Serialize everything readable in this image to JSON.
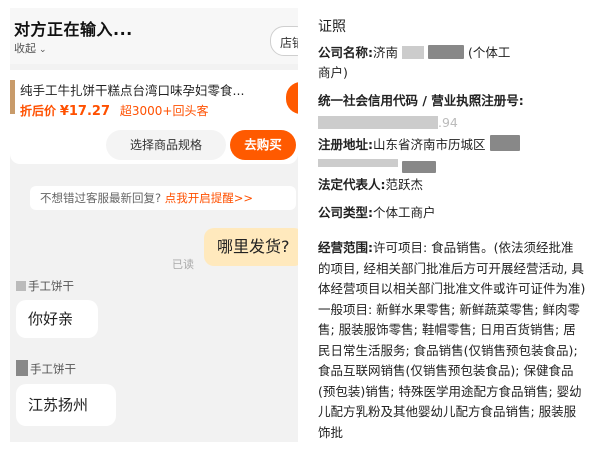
{
  "chat": {
    "title": "对方正在输入...",
    "collapse": "收起",
    "shop_button": "店铺",
    "product": {
      "name": "纯手工牛扎饼干糕点台湾口味孕妇零食...",
      "price_label": "折后价",
      "price": "¥17.27",
      "sales": "超3000+回头客",
      "spec_button": "选择商品规格",
      "buy_button": "去购买"
    },
    "notice": {
      "text": "不想错过客服最新回复?",
      "link": "点我开启提醒>>"
    },
    "messages": [
      {
        "from": "me",
        "text": "哪里发货?",
        "status": "已读"
      },
      {
        "from": "shop",
        "sender": "手工饼干",
        "text": "你好亲"
      },
      {
        "from": "shop",
        "sender": "手工饼干",
        "text": "江苏扬州"
      }
    ]
  },
  "license": {
    "title": "证照",
    "company_name_label": "公司名称:",
    "company_name_prefix": "济南",
    "company_name_suffix": "(个体工",
    "company_name_suffix2": "商户)",
    "credit_code_label": "统一社会信用代码 / 营业执照注册号:",
    "credit_code_tail": ".94",
    "address_label": "注册地址:",
    "address_value": "山东省济南市历城区",
    "rep_label": "法定代表人:",
    "rep_value": "范跃杰",
    "type_label": "公司类型:",
    "type_value": "个体工商户",
    "scope_label": "经营范围:",
    "scope_value": "许可项目: 食品销售。(依法须经批准的项目, 经相关部门批准后方可开展经营活动, 具体经营项目以相关部门批准文件或许可证件为准)一般项目: 新鲜水果零售; 新鲜蔬菜零售; 鲜肉零售; 服装服饰零售; 鞋帽零售; 日用百货销售; 居民日常生活服务; 食品销售(仅销售预包装食品); 食品互联网销售(仅销售预包装食品); 保健食品(预包装)销售; 特殊医学用途配方食品销售; 婴幼儿配方乳粉及其他婴幼儿配方食品销售; 服装服饰批"
  },
  "colors": {
    "accent": "#ff5000",
    "my_bubble": "#ffe9bd",
    "chat_bg": "#f2f2f2"
  }
}
